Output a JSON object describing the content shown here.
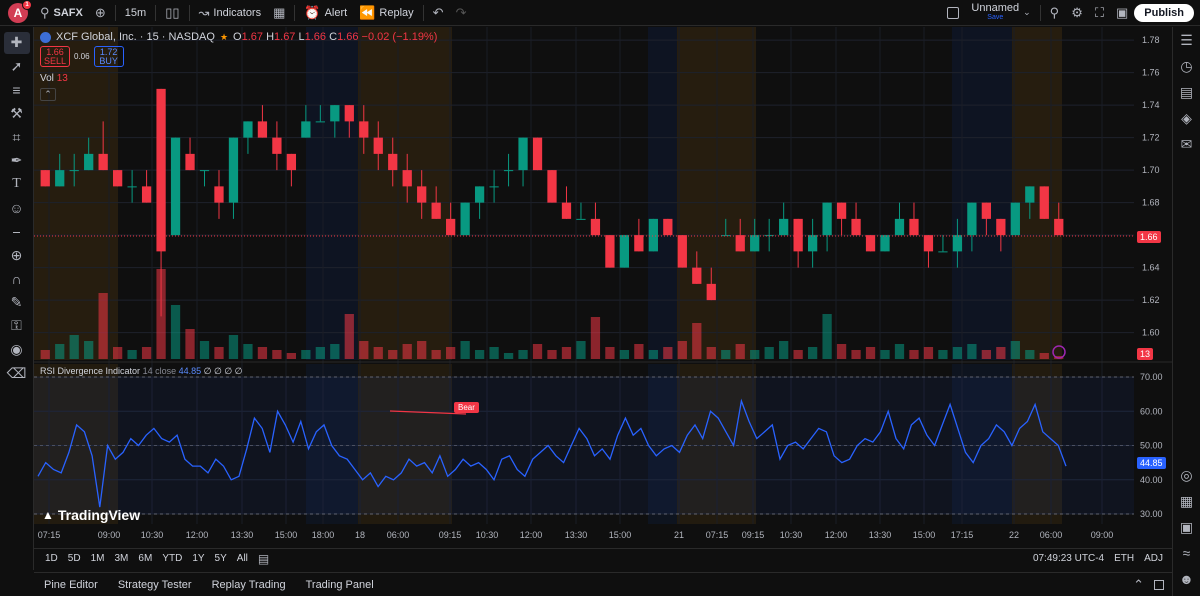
{
  "topbar": {
    "avatar_letter": "A",
    "avatar_badge": "1",
    "symbol": "SAFX",
    "interval": "15m",
    "indicators_label": "Indicators",
    "alert_label": "Alert",
    "replay_label": "Replay",
    "layout_name": "Unnamed",
    "layout_status": "Save",
    "publish_label": "Publish"
  },
  "legend": {
    "title": "XCF Global, Inc. · 15 · NASDAQ",
    "o_label": "O",
    "o_value": "1.67",
    "h_label": "H",
    "h_value": "1.67",
    "l_label": "L",
    "l_value": "1.66",
    "c_label": "C",
    "c_value": "1.66",
    "change": "−0.02 (−1.19%)"
  },
  "trade": {
    "sell_price": "1.66",
    "sell_label": "SELL",
    "spread": "0.06",
    "buy_price": "1.72",
    "buy_label": "BUY"
  },
  "volume": {
    "label": "Vol",
    "value": "13"
  },
  "rsi_legend": {
    "name": "RSI Divergence Indicator",
    "params": "14 close",
    "value": "44.85",
    "extras": "∅ ∅ ∅ ∅"
  },
  "price_axis": {
    "labels": [
      "1.78",
      "1.76",
      "1.74",
      "1.72",
      "1.70",
      "1.68",
      "1.66",
      "1.64",
      "1.62",
      "1.60"
    ],
    "current": "1.66",
    "vol_current": "13"
  },
  "rsi_axis": {
    "labels": [
      "70.00",
      "60.00",
      "50.00",
      "40.00",
      "30.00"
    ],
    "current": "44.85"
  },
  "time_axis": {
    "labels": [
      "07:15",
      "09:00",
      "10:30",
      "12:00",
      "13:30",
      "15:00",
      "18:00",
      "18",
      "06:00",
      "09:15",
      "10:30",
      "12:00",
      "13:30",
      "15:00",
      "21",
      "07:15",
      "09:15",
      "10:30",
      "12:00",
      "13:30",
      "15:00",
      "17:15",
      "22",
      "06:00",
      "09:00"
    ]
  },
  "bear_label": "Bear",
  "brand": "TradingView",
  "ranges": [
    "1D",
    "5D",
    "1M",
    "3M",
    "6M",
    "YTD",
    "1Y",
    "5Y",
    "All"
  ],
  "status": {
    "clock": "07:49:23 UTC-4",
    "session": "ETH",
    "adj": "ADJ"
  },
  "footer_tabs": [
    "Pine Editor",
    "Strategy Tester",
    "Replay Trading",
    "Trading Panel"
  ],
  "icons": {
    "left_toolbar": [
      "crosshair-icon",
      "trend-line-icon",
      "fib-icon",
      "pattern-icon",
      "projection-icon",
      "brush-icon",
      "text-icon",
      "emoji-icon",
      "ruler-icon",
      "zoom-icon",
      "magnet-icon",
      "lock-drawings-icon",
      "lock-icon",
      "eye-icon",
      "trash-icon"
    ],
    "right_toolbar": [
      "watchlist-icon",
      "alerts-clock-icon",
      "calendar-icon",
      "layers-icon",
      "chat-icon",
      "target-icon",
      "ideas-icon",
      "data-window-icon",
      "broadcast-icon",
      "notifications-icon"
    ]
  },
  "colors": {
    "bull": "#089981",
    "bear": "#f23645",
    "rsi_line": "#2962ff",
    "session_pre": "#3a2a10",
    "session_post": "#0e1a33"
  },
  "chart_data": {
    "type": "candlestick",
    "title": "XCF Global, Inc. · 15 · NASDAQ",
    "price_range": [
      1.585,
      1.785
    ],
    "ohlc": [
      [
        1.7,
        1.7,
        1.69,
        1.69
      ],
      [
        1.69,
        1.71,
        1.69,
        1.7
      ],
      [
        1.7,
        1.71,
        1.69,
        1.7
      ],
      [
        1.7,
        1.72,
        1.7,
        1.71
      ],
      [
        1.71,
        1.73,
        1.7,
        1.7
      ],
      [
        1.7,
        1.7,
        1.69,
        1.69
      ],
      [
        1.69,
        1.7,
        1.68,
        1.69
      ],
      [
        1.69,
        1.7,
        1.68,
        1.68
      ],
      [
        1.75,
        1.75,
        1.61,
        1.65
      ],
      [
        1.66,
        1.72,
        1.66,
        1.72
      ],
      [
        1.71,
        1.72,
        1.7,
        1.7
      ],
      [
        1.7,
        1.7,
        1.69,
        1.7
      ],
      [
        1.69,
        1.7,
        1.67,
        1.68
      ],
      [
        1.68,
        1.72,
        1.67,
        1.72
      ],
      [
        1.72,
        1.73,
        1.71,
        1.73
      ],
      [
        1.73,
        1.74,
        1.72,
        1.72
      ],
      [
        1.72,
        1.73,
        1.7,
        1.71
      ],
      [
        1.71,
        1.71,
        1.69,
        1.7
      ],
      [
        1.72,
        1.74,
        1.72,
        1.73
      ],
      [
        1.73,
        1.74,
        1.73,
        1.73
      ],
      [
        1.73,
        1.74,
        1.72,
        1.74
      ],
      [
        1.74,
        1.74,
        1.72,
        1.73
      ],
      [
        1.73,
        1.74,
        1.71,
        1.72
      ],
      [
        1.72,
        1.73,
        1.7,
        1.71
      ],
      [
        1.71,
        1.72,
        1.69,
        1.7
      ],
      [
        1.7,
        1.71,
        1.68,
        1.69
      ],
      [
        1.69,
        1.7,
        1.67,
        1.68
      ],
      [
        1.68,
        1.69,
        1.67,
        1.67
      ],
      [
        1.67,
        1.68,
        1.66,
        1.66
      ],
      [
        1.66,
        1.68,
        1.66,
        1.68
      ],
      [
        1.68,
        1.69,
        1.67,
        1.69
      ],
      [
        1.69,
        1.7,
        1.68,
        1.69
      ],
      [
        1.7,
        1.71,
        1.69,
        1.7
      ],
      [
        1.7,
        1.72,
        1.69,
        1.72
      ],
      [
        1.72,
        1.72,
        1.7,
        1.7
      ],
      [
        1.7,
        1.7,
        1.68,
        1.68
      ],
      [
        1.68,
        1.69,
        1.67,
        1.67
      ],
      [
        1.67,
        1.68,
        1.67,
        1.67
      ],
      [
        1.67,
        1.68,
        1.66,
        1.66
      ],
      [
        1.66,
        1.66,
        1.64,
        1.64
      ],
      [
        1.64,
        1.66,
        1.64,
        1.66
      ],
      [
        1.66,
        1.67,
        1.65,
        1.65
      ],
      [
        1.65,
        1.67,
        1.65,
        1.67
      ],
      [
        1.67,
        1.67,
        1.66,
        1.66
      ],
      [
        1.66,
        1.66,
        1.64,
        1.64
      ],
      [
        1.64,
        1.65,
        1.63,
        1.63
      ],
      [
        1.63,
        1.64,
        1.62,
        1.62
      ],
      [
        1.66,
        1.67,
        1.66,
        1.66
      ],
      [
        1.66,
        1.67,
        1.65,
        1.65
      ],
      [
        1.65,
        1.67,
        1.65,
        1.66
      ],
      [
        1.66,
        1.67,
        1.65,
        1.66
      ],
      [
        1.66,
        1.68,
        1.66,
        1.67
      ],
      [
        1.67,
        1.67,
        1.64,
        1.65
      ],
      [
        1.65,
        1.67,
        1.64,
        1.66
      ],
      [
        1.66,
        1.68,
        1.65,
        1.68
      ],
      [
        1.68,
        1.68,
        1.66,
        1.67
      ],
      [
        1.67,
        1.68,
        1.66,
        1.66
      ],
      [
        1.66,
        1.66,
        1.65,
        1.65
      ],
      [
        1.65,
        1.66,
        1.65,
        1.66
      ],
      [
        1.66,
        1.68,
        1.66,
        1.67
      ],
      [
        1.67,
        1.68,
        1.66,
        1.66
      ],
      [
        1.66,
        1.66,
        1.64,
        1.65
      ],
      [
        1.65,
        1.66,
        1.65,
        1.65
      ],
      [
        1.65,
        1.67,
        1.64,
        1.66
      ],
      [
        1.66,
        1.68,
        1.65,
        1.68
      ],
      [
        1.68,
        1.68,
        1.66,
        1.67
      ],
      [
        1.67,
        1.67,
        1.65,
        1.66
      ],
      [
        1.66,
        1.68,
        1.66,
        1.68
      ],
      [
        1.68,
        1.69,
        1.67,
        1.69
      ],
      [
        1.69,
        1.69,
        1.67,
        1.67
      ],
      [
        1.67,
        1.68,
        1.66,
        1.66
      ]
    ],
    "volume": [
      3,
      5,
      8,
      6,
      22,
      4,
      3,
      4,
      30,
      18,
      10,
      6,
      4,
      8,
      5,
      4,
      3,
      2,
      3,
      4,
      5,
      15,
      6,
      4,
      3,
      5,
      6,
      3,
      4,
      6,
      3,
      4,
      2,
      3,
      5,
      3,
      4,
      6,
      14,
      4,
      3,
      5,
      3,
      4,
      6,
      12,
      4,
      3,
      5,
      3,
      4,
      6,
      3,
      4,
      15,
      5,
      3,
      4,
      3,
      5,
      3,
      4,
      3,
      4,
      5,
      3,
      4,
      6,
      3,
      2,
      1
    ],
    "rsi": [
      41,
      45,
      43,
      42,
      48,
      56,
      54,
      47,
      32,
      50,
      46,
      48,
      52,
      50,
      53,
      55,
      52,
      51,
      53,
      46,
      44,
      44,
      42,
      46,
      44,
      40,
      41,
      49,
      58,
      55,
      48,
      60,
      56,
      51,
      57,
      49,
      54,
      56,
      50,
      47,
      46,
      43,
      40,
      42,
      38,
      41,
      40,
      42,
      46,
      44,
      45,
      42,
      47,
      41,
      43,
      46,
      44,
      45,
      43,
      40,
      46,
      47,
      43,
      41,
      46,
      48,
      50,
      47,
      45,
      50,
      55,
      52,
      47,
      49,
      46,
      53,
      58,
      53,
      55,
      50,
      47,
      49,
      50,
      48,
      53,
      56,
      52,
      60,
      58,
      54,
      50,
      63,
      57,
      52,
      54,
      56,
      46,
      50,
      51,
      49,
      52,
      55,
      54,
      47,
      45,
      46,
      50,
      52,
      51,
      54,
      60,
      52,
      49,
      56,
      58,
      53,
      50,
      56,
      62,
      55,
      48,
      45,
      50,
      52,
      56,
      54,
      50,
      55,
      57,
      62,
      54,
      52,
      50,
      44
    ]
  }
}
